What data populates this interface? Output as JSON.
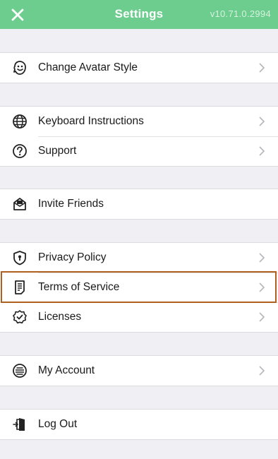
{
  "header": {
    "title": "Settings",
    "version": "v10.71.0.2994",
    "background_color": "#6ccd8e",
    "close_icon": "close-icon"
  },
  "groups": [
    {
      "items": [
        {
          "label": "Change Avatar Style",
          "icon": "avatar-face-icon"
        }
      ]
    },
    {
      "items": [
        {
          "label": "Keyboard Instructions",
          "icon": "globe-icon"
        },
        {
          "label": "Support",
          "icon": "question-circle-icon"
        }
      ]
    },
    {
      "items": [
        {
          "label": "Invite Friends",
          "icon": "envelope-icon"
        }
      ]
    },
    {
      "items": [
        {
          "label": "Privacy Policy",
          "icon": "shield-icon"
        },
        {
          "label": "Terms of Service",
          "icon": "document-icon",
          "highlighted": true
        },
        {
          "label": "Licenses",
          "icon": "check-badge-icon"
        }
      ]
    },
    {
      "items": [
        {
          "label": "My Account",
          "icon": "account-icon"
        }
      ]
    },
    {
      "items": [
        {
          "label": "Log Out",
          "icon": "logout-door-icon"
        }
      ]
    }
  ],
  "colors": {
    "highlight_border": "#b0601e",
    "background": "#f0f0f4"
  }
}
